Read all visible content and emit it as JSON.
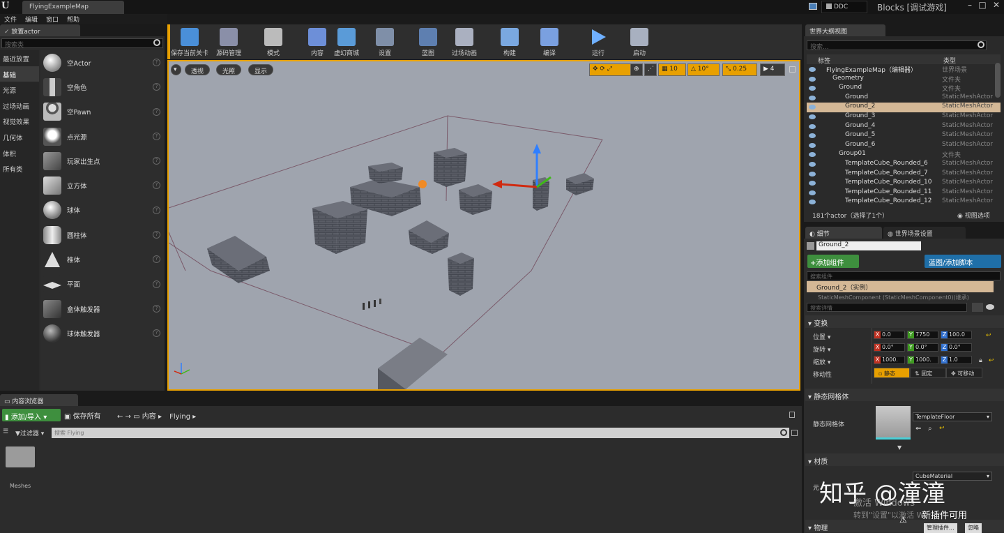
{
  "window": {
    "tab": "FlyingExampleMap",
    "ddc": "DDC",
    "project": "Blocks [调试游戏]"
  },
  "menu": [
    "文件",
    "编辑",
    "窗口",
    "帮助"
  ],
  "place_actor": {
    "tab": "放置actor",
    "search_placeholder": "搜索类",
    "categories": [
      "最近放置",
      "基础",
      "光源",
      "过场动画",
      "视觉效果",
      "几何体",
      "体积",
      "所有类"
    ],
    "active_category": "基础",
    "items": [
      {
        "label": "空Actor",
        "icon": "sphere-icon"
      },
      {
        "label": "空角色",
        "icon": "character-icon"
      },
      {
        "label": "空Pawn",
        "icon": "pawn-icon"
      },
      {
        "label": "点光源",
        "icon": "point-light-icon"
      },
      {
        "label": "玩家出生点",
        "icon": "player-start-icon"
      },
      {
        "label": "立方体",
        "icon": "cube-icon"
      },
      {
        "label": "球体",
        "icon": "sphere-icon"
      },
      {
        "label": "圆柱体",
        "icon": "cylinder-icon"
      },
      {
        "label": "椎体",
        "icon": "cone-icon"
      },
      {
        "label": "平面",
        "icon": "plane-icon"
      },
      {
        "label": "盒体触发器",
        "icon": "box-trigger-icon"
      },
      {
        "label": "球体触发器",
        "icon": "sphere-trigger-icon"
      }
    ]
  },
  "toolbar": [
    {
      "label": "保存当前关卡",
      "icon": "save-icon",
      "color": "#4a8fd8"
    },
    {
      "label": "源码管理",
      "icon": "source-control-icon",
      "color": "#8a8fa8"
    },
    {
      "label": "模式",
      "icon": "modes-icon",
      "color": "#bbbbbb"
    },
    {
      "label": "内容",
      "icon": "content-icon",
      "color": "#6d8fd8"
    },
    {
      "label": "虚幻商城",
      "icon": "marketplace-icon",
      "color": "#5a9bd8"
    },
    {
      "label": "设置",
      "icon": "settings-icon",
      "color": "#7f8fa8"
    },
    {
      "label": "蓝图",
      "icon": "blueprint-icon",
      "color": "#5e7fb0"
    },
    {
      "label": "过场动画",
      "icon": "cinematics-icon",
      "color": "#aab0c0"
    },
    {
      "label": "构建",
      "icon": "build-icon",
      "color": "#7aa8e0"
    },
    {
      "label": "编译",
      "icon": "compile-icon",
      "color": "#7aa0e0"
    },
    {
      "label": "运行",
      "icon": "play-icon",
      "color": "#6fb0ff"
    },
    {
      "label": "启动",
      "icon": "launch-icon",
      "color": "#a8b0c0"
    }
  ],
  "viewport": {
    "left_buttons": [
      "透视",
      "光照",
      "显示"
    ],
    "snap_grid": "10",
    "snap_rotate": "10°",
    "snap_scale": "0.25",
    "camera_speed": "4"
  },
  "outliner": {
    "tab": "世界大纲视图",
    "search_placeholder": "搜索...",
    "col_label": "标签",
    "col_type": "类型",
    "rows": [
      {
        "label": "FlyingExampleMap（编辑器）",
        "type": "世界场景",
        "indent": 1
      },
      {
        "label": "Geometry",
        "type": "文件夹",
        "indent": 2
      },
      {
        "label": "Ground",
        "type": "文件夹",
        "indent": 3
      },
      {
        "label": "Ground",
        "type": "StaticMeshActor",
        "indent": 4
      },
      {
        "label": "Ground_2",
        "type": "StaticMeshActor",
        "indent": 4,
        "selected": true
      },
      {
        "label": "Ground_3",
        "type": "StaticMeshActor",
        "indent": 4
      },
      {
        "label": "Ground_4",
        "type": "StaticMeshActor",
        "indent": 4
      },
      {
        "label": "Ground_5",
        "type": "StaticMeshActor",
        "indent": 4
      },
      {
        "label": "Ground_6",
        "type": "StaticMeshActor",
        "indent": 4
      },
      {
        "label": "Group01",
        "type": "文件夹",
        "indent": 3
      },
      {
        "label": "TemplateCube_Rounded_6",
        "type": "StaticMeshActor",
        "indent": 4
      },
      {
        "label": "TemplateCube_Rounded_7",
        "type": "StaticMeshActor",
        "indent": 4
      },
      {
        "label": "TemplateCube_Rounded_10",
        "type": "StaticMeshActor",
        "indent": 4
      },
      {
        "label": "TemplateCube_Rounded_11",
        "type": "StaticMeshActor",
        "indent": 4
      },
      {
        "label": "TemplateCube_Rounded_12",
        "type": "StaticMeshActor",
        "indent": 4
      }
    ],
    "footer_count": "181个actor（选择了1个）",
    "view_options": "视图选项"
  },
  "details": {
    "tab1": "细节",
    "tab2": "世界场景设置",
    "name": "Ground_2",
    "add_component": "+添加组件",
    "blueprint_button": "蓝图/添加脚本",
    "search_components": "搜索组件",
    "instance": "Ground_2（实例）",
    "sub_component": "StaticMeshComponent (StaticMeshComponent0)(继承)",
    "search_details": "搜索详情",
    "transform_section": "变换",
    "location_label": "位置",
    "location": {
      "x": "0.0",
      "y": "7750",
      "z": "100.0"
    },
    "rotation_label": "旋转",
    "rotation": {
      "x": "0.0°",
      "y": "0.0°",
      "z": "0.0°"
    },
    "scale_label": "缩放",
    "scale": {
      "x": "1000.",
      "y": "1000.",
      "z": "1.0"
    },
    "mobility_label": "移动性",
    "mobility": [
      "静态",
      "固定",
      "可移动"
    ],
    "static_mesh_section": "静态网格体",
    "static_mesh_label": "静态网格体",
    "static_mesh_value": "TemplateFloor",
    "materials_section": "材质",
    "material_label": "元",
    "material_value": "CubeMaterial",
    "physics_section": "物理"
  },
  "overlay": {
    "watermark": "知乎 @潼潼",
    "activate1": "激活 Windows",
    "activate2": "转到\"设置\"以激活 W",
    "plugin_note": "新插件可用",
    "manage_plugins": "管理插件...",
    "ignore": "忽略"
  },
  "content_browser": {
    "tab": "内容浏览器",
    "add_import": "添加/导入",
    "save_all": "保存所有",
    "path": [
      "内容",
      "Flying"
    ],
    "filters": "过滤器",
    "search_placeholder": "搜索 Flying",
    "folders": [
      {
        "label": "Meshes"
      }
    ]
  }
}
